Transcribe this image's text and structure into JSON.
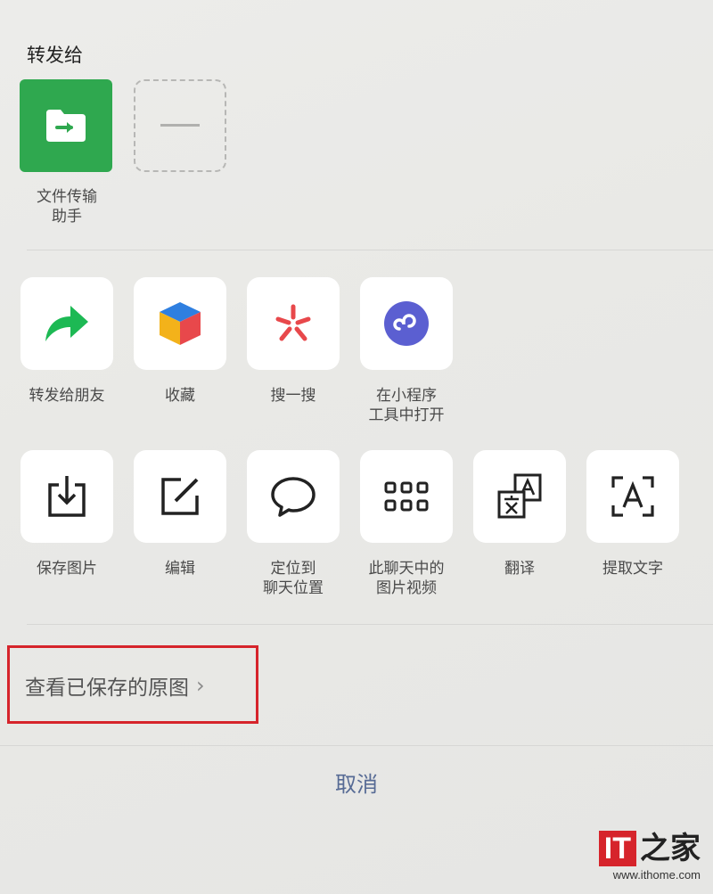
{
  "share_to": {
    "title": "转发给",
    "contacts": [
      {
        "label": "文件传输助手",
        "label_line1": "文件传输",
        "label_line2": "助手",
        "icon": "folder-arrow-icon",
        "color": "#2fa84f"
      },
      {
        "label": "",
        "icon": "more-contacts-icon"
      }
    ]
  },
  "actions_row1": [
    {
      "label_line1": "转发给朋友",
      "label_line2": "",
      "icon": "forward-arrow-icon"
    },
    {
      "label_line1": "收藏",
      "label_line2": "",
      "icon": "favorite-cube-icon"
    },
    {
      "label_line1": "搜一搜",
      "label_line2": "",
      "icon": "search-spark-icon"
    },
    {
      "label_line1": "在小程序",
      "label_line2": "工具中打开",
      "icon": "mini-program-icon"
    }
  ],
  "actions_row2": [
    {
      "label_line1": "保存图片",
      "label_line2": "",
      "icon": "save-download-icon"
    },
    {
      "label_line1": "编辑",
      "label_line2": "",
      "icon": "edit-pencil-icon"
    },
    {
      "label_line1": "定位到",
      "label_line2": "聊天位置",
      "icon": "chat-bubble-icon"
    },
    {
      "label_line1": "此聊天中的",
      "label_line2": "图片视频",
      "icon": "grid-icon"
    },
    {
      "label_line1": "翻译",
      "label_line2": "",
      "icon": "translate-icon"
    },
    {
      "label_line1": "提取文字",
      "label_line2": "",
      "icon": "extract-text-icon"
    }
  ],
  "saved_original": {
    "label": "查看已保存的原图",
    "chevron": "›"
  },
  "cancel_label": "取消",
  "watermark": {
    "brand": "IT",
    "glyph": "之家",
    "url": "www.ithome.com"
  },
  "colors": {
    "accent_link": "#576b95",
    "file_transfer_green": "#2fa84f",
    "forward_green": "#1db954",
    "highlight_red": "#d6242b",
    "mini_program_purple": "#5b5fd1",
    "search_red": "#e8484b"
  }
}
